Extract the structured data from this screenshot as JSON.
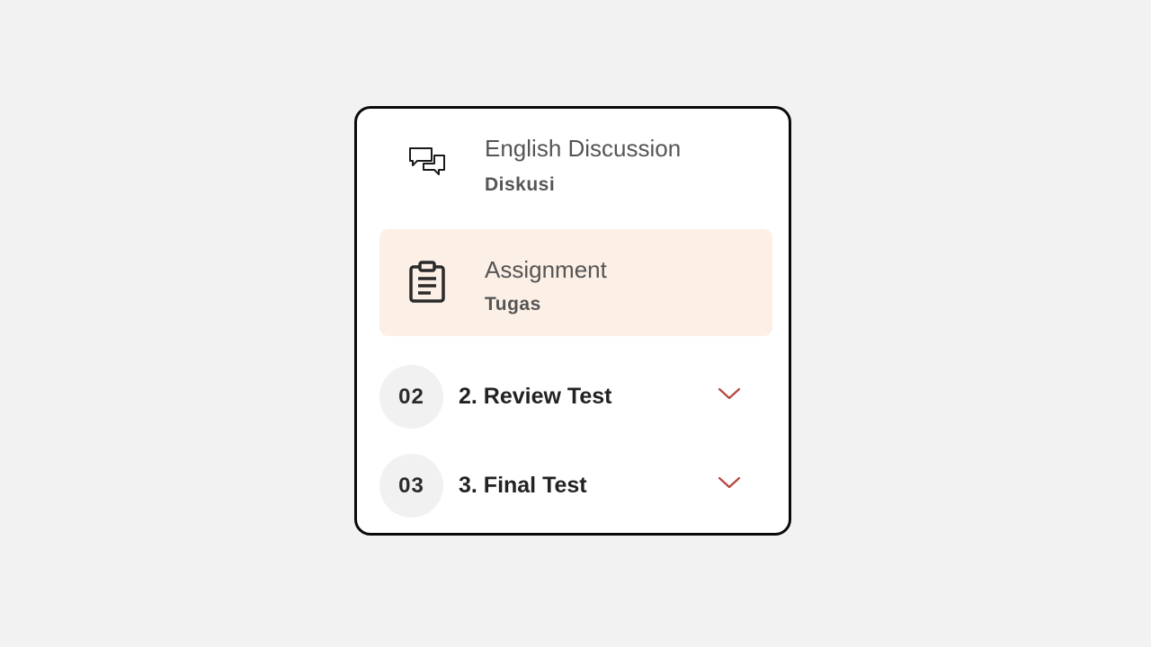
{
  "lessons": [
    {
      "title": "English Discussion",
      "type_label": "Diskusi",
      "icon": "chat-bubbles-icon",
      "active": false
    },
    {
      "title": "Assignment",
      "type_label": "Tugas",
      "icon": "clipboard-list-icon",
      "active": true
    }
  ],
  "sections": [
    {
      "number": "02",
      "title": "2. Review Test",
      "expanded": false
    },
    {
      "number": "03",
      "title": "3. Final Test",
      "expanded": false
    }
  ],
  "colors": {
    "active_background": "#fcefe6",
    "chevron": "#b5473f",
    "card_border": "#0a0a0a",
    "number_badge": "#f1f1f1"
  }
}
